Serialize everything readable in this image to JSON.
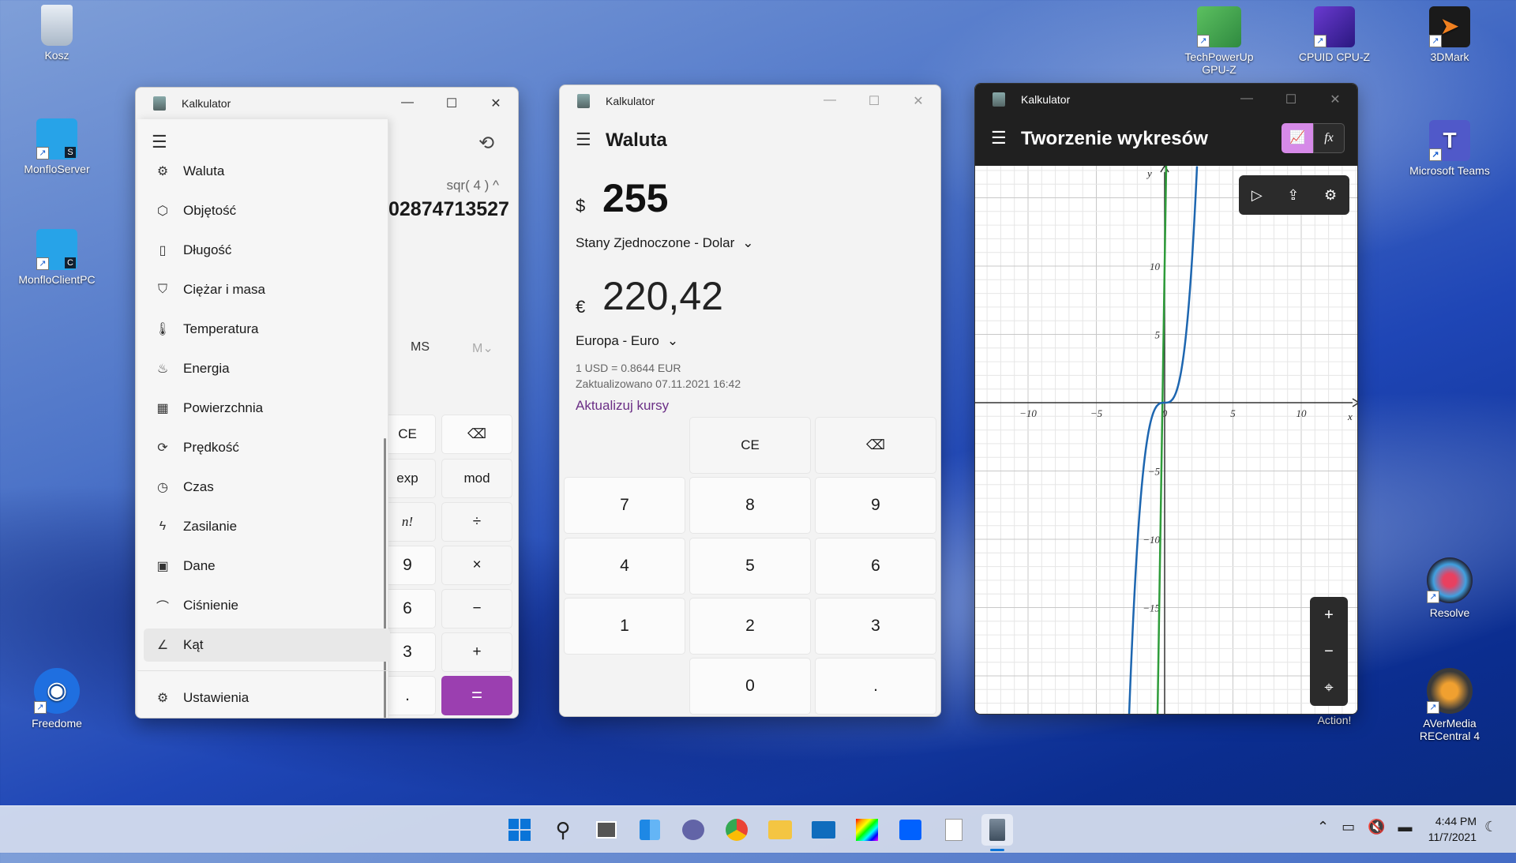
{
  "desktop": {
    "icons": [
      {
        "label": "Kosz",
        "glyph": "🗑"
      },
      {
        "label": "MonfloServer",
        "glyph": "S"
      },
      {
        "label": "MonfloClientPC",
        "glyph": "C"
      },
      {
        "label": "Freedome",
        "glyph": "◉"
      },
      {
        "label": "TechPowerUp GPU-Z",
        "glyph": "▦"
      },
      {
        "label": "CPUID CPU-Z",
        "glyph": "▣"
      },
      {
        "label": "3DMark",
        "glyph": "➤"
      },
      {
        "label": "Microsoft Teams",
        "glyph": "T"
      },
      {
        "label": "Resolve",
        "glyph": "●"
      },
      {
        "label": "Action!",
        "glyph": "◎"
      },
      {
        "label": "AVerMedia RECentral 4",
        "glyph": "◌"
      }
    ]
  },
  "win1": {
    "title": "Kalkulator",
    "controls": {
      "min": "—",
      "max": "☐",
      "close": "✕"
    },
    "menu_icon": "☰",
    "history_icon": "⟲",
    "expression": "sqr( 4 ) ^",
    "display": "02874713527",
    "memory": {
      "ms": "MS",
      "mv": "M⌄"
    },
    "menu": [
      {
        "label": "Waluta",
        "icon": "⚙"
      },
      {
        "label": "Objętość",
        "icon": "⬡"
      },
      {
        "label": "Długość",
        "icon": "▯"
      },
      {
        "label": "Ciężar i masa",
        "icon": "⛉"
      },
      {
        "label": "Temperatura",
        "icon": "🌡"
      },
      {
        "label": "Energia",
        "icon": "♨"
      },
      {
        "label": "Powierzchnia",
        "icon": "▦"
      },
      {
        "label": "Prędkość",
        "icon": "⟳"
      },
      {
        "label": "Czas",
        "icon": "◷"
      },
      {
        "label": "Zasilanie",
        "icon": "ϟ"
      },
      {
        "label": "Dane",
        "icon": "▣"
      },
      {
        "label": "Ciśnienie",
        "icon": "⌒"
      },
      {
        "label": "Kąt",
        "icon": "∠"
      }
    ],
    "settings": {
      "label": "Ustawienia",
      "icon": "⚙"
    },
    "keys": [
      "CE",
      "⌫",
      "exp",
      "mod",
      "n!",
      "÷",
      "9",
      "×",
      "6",
      "−",
      "3",
      "+",
      ".",
      "="
    ]
  },
  "win2": {
    "title": "Kalkulator",
    "controls": {
      "min": "—",
      "max": "☐",
      "close": "✕"
    },
    "mode": "Waluta",
    "menu_icon": "☰",
    "from": {
      "symbol": "$",
      "value": "255",
      "currency": "Stany Zjednoczone - Dolar"
    },
    "to": {
      "symbol": "€",
      "value": "220,42",
      "currency": "Europa - Euro"
    },
    "rate": "1 USD = 0.8644 EUR",
    "updated": "Zaktualizowano 07.11.2021 16:42",
    "update_link": "Aktualizuj kursy",
    "chevron": "⌄",
    "keys": [
      "CE",
      "⌫",
      "7",
      "8",
      "9",
      "4",
      "5",
      "6",
      "1",
      "2",
      "3",
      "0",
      "."
    ]
  },
  "win3": {
    "title": "Kalkulator",
    "controls": {
      "min": "—",
      "max": "☐",
      "close": "✕"
    },
    "mode": "Tworzenie wykresów",
    "menu_icon": "☰",
    "graph_icon": "📈",
    "fx_icon": "fx",
    "tools": {
      "select": "▷",
      "share": "⇪",
      "settings": "⚙"
    },
    "zoom": {
      "in": "+",
      "out": "−",
      "reset": "⌖"
    },
    "axis": {
      "x": "x",
      "y": "y"
    },
    "xticks": [
      "−10",
      "−5",
      "0",
      "5",
      "10"
    ],
    "yticks": [
      "10",
      "5",
      "−5",
      "−10",
      "−15"
    ]
  },
  "taskbar": {
    "apps": [
      "start",
      "search",
      "taskview",
      "widgets",
      "chat",
      "chrome",
      "explorer",
      "mail",
      "colors",
      "dropbox",
      "notepad",
      "calculator"
    ],
    "time": "4:44 PM",
    "date": "11/7/2021",
    "tray": [
      "⌃",
      "▭",
      "🔇",
      "▬"
    ]
  }
}
